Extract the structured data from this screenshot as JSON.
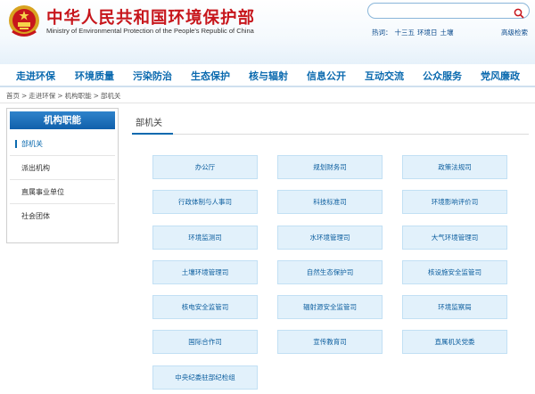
{
  "site": {
    "title": "中华人民共和国环境保护部",
    "subtitle": "Ministry of Environmental Protection of the People's Republic of China"
  },
  "search": {
    "placeholder": "",
    "hot_label": "热词：",
    "hot_words": [
      "十三五",
      "环境日",
      "土壤"
    ],
    "advanced": "高级检索"
  },
  "nav": {
    "items": [
      "走进环保",
      "环境质量",
      "污染防治",
      "生态保护",
      "核与辐射",
      "信息公开",
      "互动交流",
      "公众服务",
      "党风廉政"
    ]
  },
  "breadcrumb": [
    "首页",
    ">",
    "走进环保",
    ">",
    "机构职能",
    ">",
    "部机关"
  ],
  "sidebar": {
    "title": "机构职能",
    "items": [
      "部机关",
      "派出机构",
      "直属事业单位",
      "社会团体"
    ]
  },
  "main": {
    "title": "部机关",
    "departments": [
      "办公厅",
      "规划财务司",
      "政策法规司",
      "行政体制与人事司",
      "科技标准司",
      "环境影响评价司",
      "环境监测司",
      "水环境管理司",
      "大气环境管理司",
      "土壤环境管理司",
      "自然生态保护司",
      "核设施安全监管司",
      "核电安全监管司",
      "辐射源安全监管司",
      "环境监察局",
      "国际合作司",
      "宣传教育司",
      "直属机关党委",
      "中央纪委驻部纪检组"
    ]
  },
  "colors": {
    "brand_red": "#c7161c",
    "nav_blue": "#0b6aaf",
    "dept_bg": "#e2f1fb"
  }
}
